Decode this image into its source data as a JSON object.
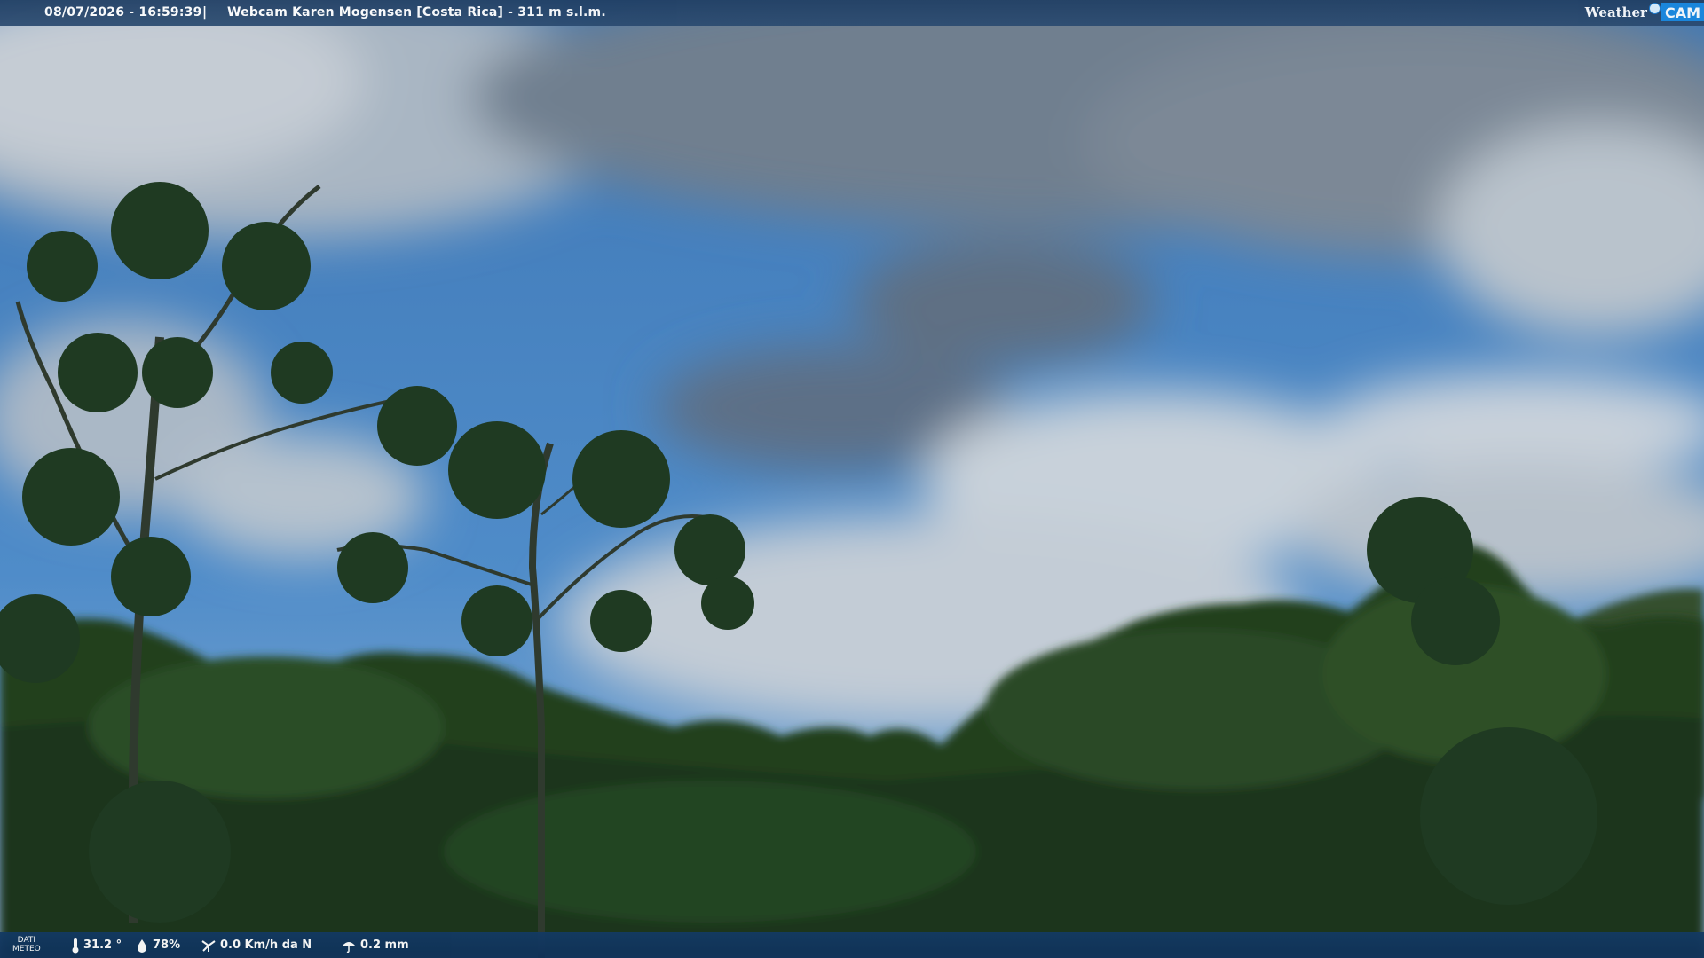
{
  "header": {
    "datetime": "08/07/2026 - 16:59:39",
    "separator": "|",
    "webcam_title": "Webcam Karen Mogensen [Costa Rica]  - 311 m s.l.m."
  },
  "brand": {
    "word": "Weather",
    "cam": "CAM"
  },
  "weather": {
    "label_line1": "DATI",
    "label_line2": "METEO",
    "temperature": "31.2 °",
    "humidity": "78%",
    "wind": "0.0 Km/h da N",
    "rain": "0.2 mm"
  },
  "icons": {
    "temperature": "thermometer-icon",
    "humidity": "humidity-drop-icon",
    "wind": "wind-icon",
    "rain": "rain-icon"
  },
  "colors": {
    "bar": "#1f3e63",
    "cam_badge": "#1788e0",
    "sky": "#4a86c6"
  }
}
